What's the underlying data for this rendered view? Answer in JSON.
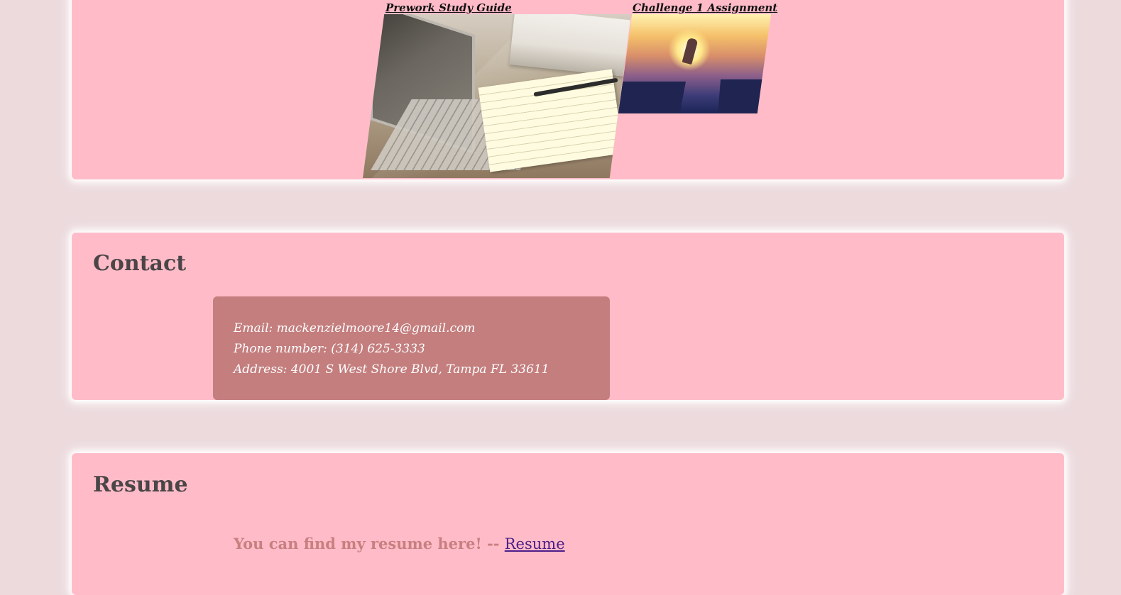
{
  "projects": {
    "items": [
      {
        "label": "Prework Study Guide",
        "image": "laptop-notebook-photo"
      },
      {
        "label": "Challenge 1 Assignment",
        "image": "cliff-jump-sunset-photo"
      }
    ]
  },
  "contact": {
    "title": "Contact",
    "email": "Email: mackenzielmoore14@gmail.com",
    "phone": "Phone number: (314) 625-3333",
    "address": "Address: 4001 S West Shore Blvd, Tampa FL 33611"
  },
  "resume": {
    "title": "Resume",
    "text": "You can find my resume here! --",
    "link_label": "Resume"
  },
  "colors": {
    "page_bg": "#ecdadd",
    "panel_bg": "#ffbcc8",
    "card_bg": "#c47e7e",
    "heading": "#4a4547",
    "resume_text": "#c87f80",
    "link": "#4b1d8a"
  }
}
